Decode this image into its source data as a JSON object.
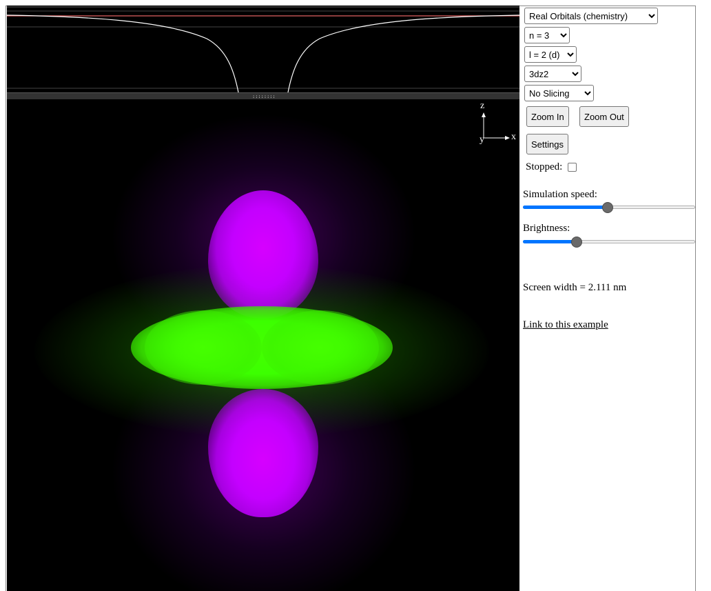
{
  "controls": {
    "mode_select": "Real Orbitals (chemistry)",
    "n_select": "n = 3",
    "l_select": "l = 2 (d)",
    "orbital_select": "3dz2",
    "slicing_select": "No Slicing",
    "zoom_in_label": "Zoom In",
    "zoom_out_label": "Zoom Out",
    "settings_label": "Settings",
    "stopped_label": "Stopped:",
    "stopped_checked": false,
    "sim_speed_label": "Simulation speed:",
    "sim_speed_value": 0.49,
    "brightness_label": "Brightness:",
    "brightness_value": 0.3,
    "screen_width_text": "Screen width = 2.111 nm",
    "link_text": "Link to this example"
  },
  "view": {
    "divider_handle": "::::::::",
    "axes": {
      "z": "z",
      "x": "x",
      "y": "y"
    }
  },
  "colors": {
    "positive_lobe": "#c400ff",
    "negative_lobe": "#3cff00",
    "potential_curve": "#ffffff",
    "energy_line": "#e06060",
    "slider_accent": "#0075ff"
  }
}
